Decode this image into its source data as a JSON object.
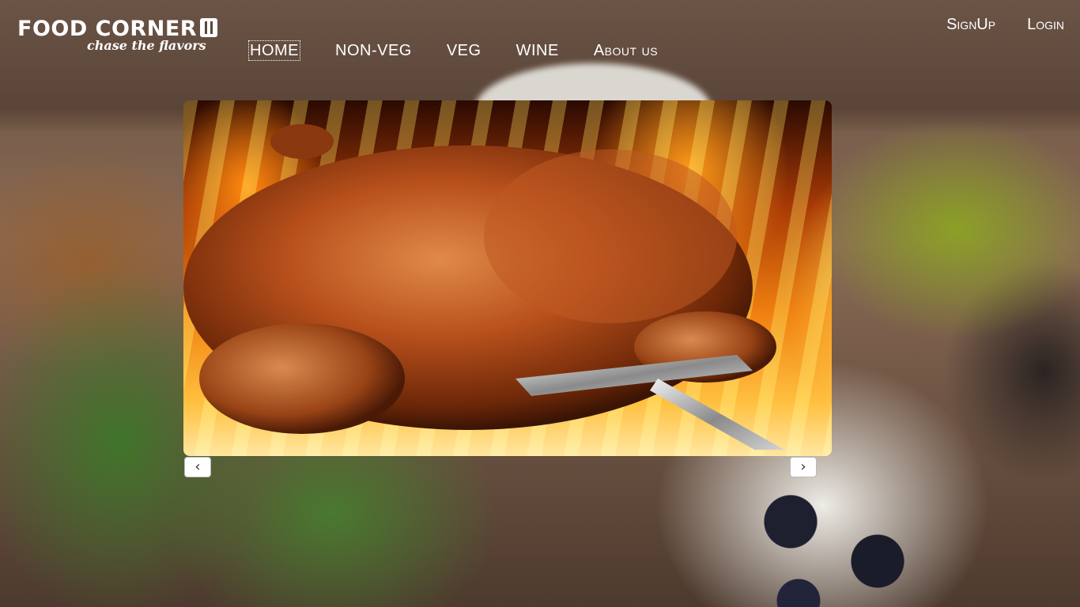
{
  "brand": {
    "title": "FOOD CORNER",
    "tagline": "chase the flavors",
    "logo_icon": "fork-knife-icon"
  },
  "nav": {
    "items": [
      {
        "label": "HOME",
        "active": true
      },
      {
        "label": "NON-VEG",
        "active": false
      },
      {
        "label": "VEG",
        "active": false
      },
      {
        "label": "WINE",
        "active": false
      },
      {
        "label": "About us",
        "active": false
      }
    ]
  },
  "auth": {
    "signup_label": "SignUp",
    "login_label": "Login"
  },
  "carousel": {
    "slide_subject": "roast chicken on flame background",
    "prev_label": "‹",
    "next_label": "›"
  },
  "colors": {
    "nav_text": "#ffffff",
    "control_bg": "#ffffff",
    "flame_orange": "#f08010"
  }
}
